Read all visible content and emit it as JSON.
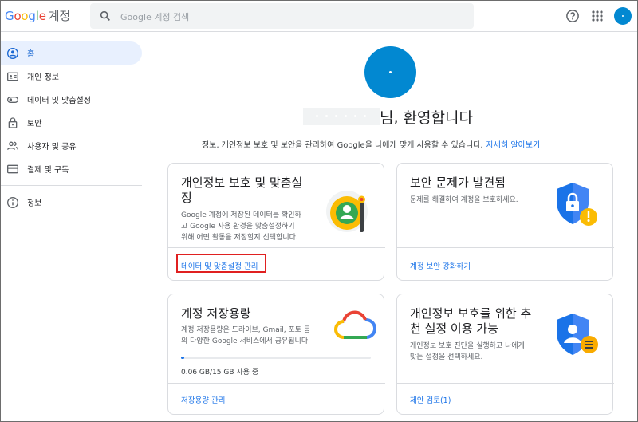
{
  "header": {
    "logo_letters": [
      "G",
      "o",
      "o",
      "g",
      "l",
      "e"
    ],
    "logo_suffix": "계정",
    "search_placeholder": "Google 계정 검색",
    "icons": [
      "search-icon",
      "help-icon",
      "apps-icon",
      "avatar"
    ]
  },
  "sidebar": {
    "items": [
      {
        "label": "홈",
        "icon": "home-icon",
        "active": true
      },
      {
        "label": "개인 정보",
        "icon": "id-card-icon"
      },
      {
        "label": "데이터 및 맞춤설정",
        "icon": "toggle-icon"
      },
      {
        "label": "보안",
        "icon": "lock-icon"
      },
      {
        "label": "사용자 및 공유",
        "icon": "people-icon"
      },
      {
        "label": "결제 및 구독",
        "icon": "credit-card-icon"
      }
    ],
    "footer_items": [
      {
        "label": "정보",
        "icon": "info-icon"
      }
    ]
  },
  "main": {
    "welcome_suffix": "님, 환영합니다",
    "subline": "정보, 개인정보 보호 및 보안을 관리하여 Google을 나에게 맞게 사용할 수 있습니다.",
    "learn_more": "자세히 알아보기",
    "cards": {
      "privacy": {
        "title_line1": "개인정보 보호 및 맞춤설",
        "title_line2": "정",
        "desc_line1": "Google 계정에 저장된 데이터를 확인하",
        "desc_line2": "고 Google 사용 환경을 맞춤설정하기",
        "desc_line3": "위해 어떤 활동을 저장할지 선택합니다.",
        "link": "데이터 및 맞춤설정 관리"
      },
      "security": {
        "title": "보안 문제가 발견됨",
        "desc": "문제를 해결하여 계정을 보호하세요.",
        "link": "계정 보안 강화하기"
      },
      "storage": {
        "title": "계정 저장용량",
        "desc_line1": "계정 저장용량은 드라이브, Gmail, 포토 등",
        "desc_line2": "의 다양한 Google 서비스에서 공유됩니다.",
        "usage": "0.06 GB/15 GB 사용 중",
        "usage_fraction": 0.004,
        "link": "저장용량 관리"
      },
      "recommend": {
        "title_line1": "개인정보 보호를 위한 추",
        "title_line2": "천 설정 이용 가능",
        "desc_line1": "개인정보 보호 진단을 실행하고 나에게",
        "desc_line2": "맞는 설정을 선택하세요.",
        "link": "제안 검토(1)"
      }
    }
  },
  "colors": {
    "accent": "#1a73e8",
    "avatar": "#0288d1",
    "highlight": "#e02020"
  }
}
